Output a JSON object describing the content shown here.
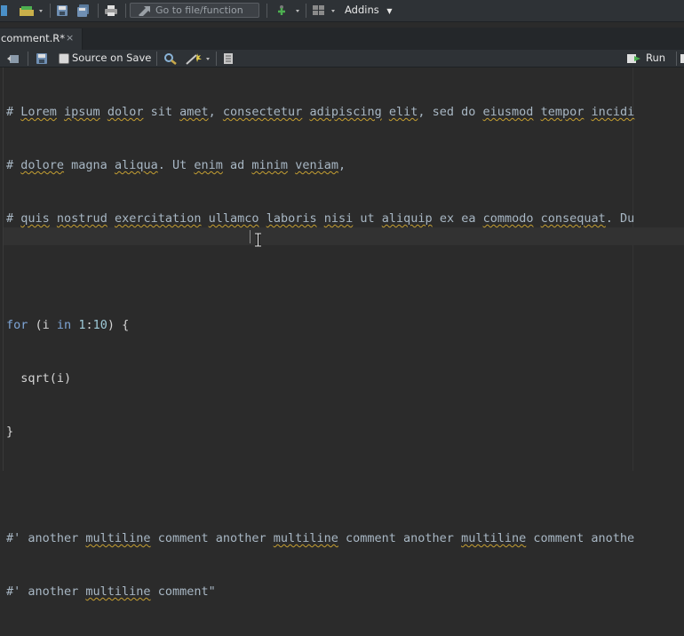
{
  "toolbar": {
    "goto_placeholder": "Go to file/function",
    "addins_label": "Addins"
  },
  "tab": {
    "name": "comment.R*",
    "close": "×"
  },
  "editor_toolbar": {
    "source_on_save": "Source on Save",
    "run_label": "Run"
  },
  "code": {
    "line1": [
      "# ",
      "Lorem",
      " ",
      "ipsum",
      " ",
      "dolor",
      " sit ",
      "amet",
      ", ",
      "consectetur",
      " ",
      "adipiscing",
      " ",
      "elit",
      ", sed do ",
      "eiusmod",
      " ",
      "tempor",
      " ",
      "incidi"
    ],
    "line2": [
      "# ",
      "dolore",
      " magna ",
      "aliqua",
      ". Ut ",
      "enim",
      " ad ",
      "minim",
      " ",
      "veniam",
      ","
    ],
    "line3": [
      "# ",
      "quis",
      " ",
      "nostrud",
      " ",
      "exercitation",
      " ",
      "ullamco",
      " ",
      "laboris",
      " ",
      "nisi",
      " ut ",
      "aliquip",
      " ex ea ",
      "commodo",
      " ",
      "consequat",
      ". Du"
    ],
    "line5": [
      "for",
      " (i ",
      "in",
      " ",
      "1",
      ":",
      "10",
      ") {"
    ],
    "line6": "  sqrt(i)",
    "line7": "}",
    "line9": [
      "#' another ",
      "multiline",
      " comment another ",
      "multiline",
      " comment another ",
      "multiline",
      " comment anothe"
    ],
    "line10": [
      "#' another ",
      "multiline",
      " comment\""
    ]
  }
}
